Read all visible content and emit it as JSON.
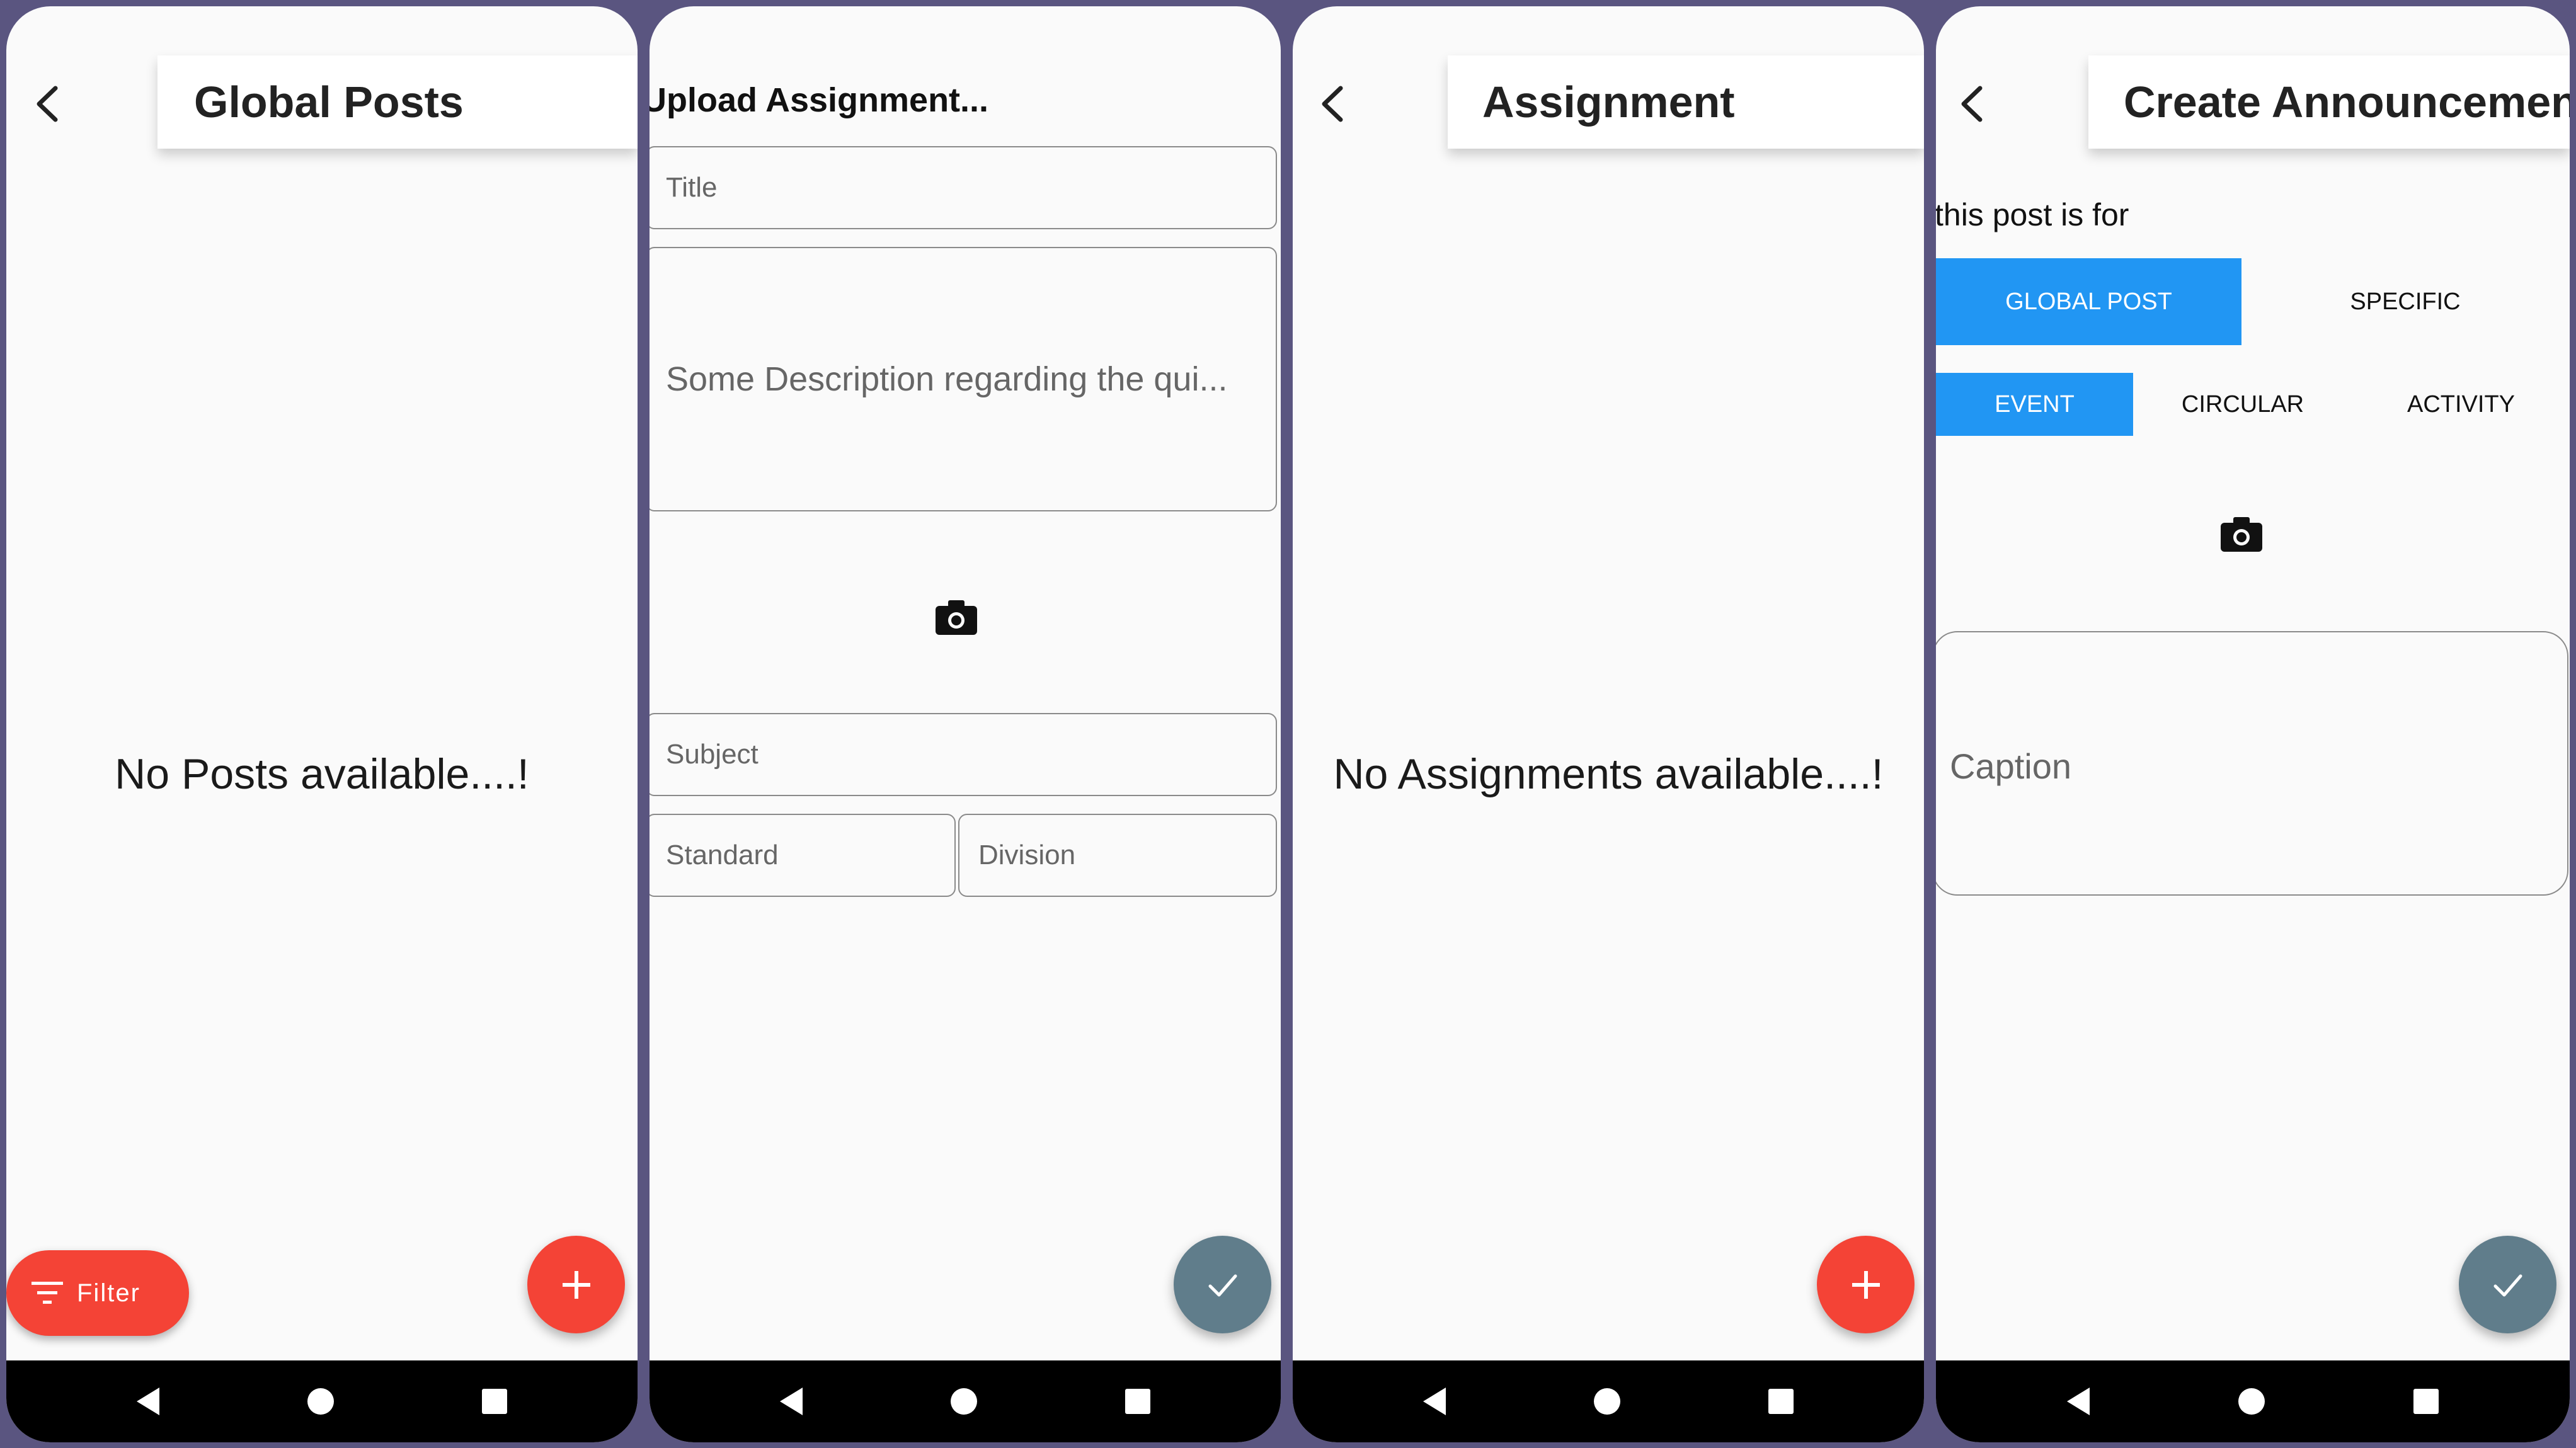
{
  "colors": {
    "frame": "#5a5580",
    "fab_red": "#f44336",
    "fab_gray": "#607d8b",
    "selected_blue": "#2196f3"
  },
  "screen1": {
    "title": "Global Posts",
    "empty_message": "No Posts available....!",
    "filter_label": "Filter",
    "icons": [
      "back-arrow-icon",
      "filter-icon",
      "plus-icon"
    ]
  },
  "screen2": {
    "title": "Upload Assignment...",
    "title_placeholder": "Title",
    "description_placeholder": "Some Description regarding the qui...",
    "subject_placeholder": "Subject",
    "standard_placeholder": "Standard",
    "division_placeholder": "Division",
    "icons": [
      "camera-icon",
      "check-icon"
    ]
  },
  "screen3": {
    "title": "Assignment",
    "empty_message": "No Assignments available....!",
    "icons": [
      "back-arrow-icon",
      "plus-icon"
    ]
  },
  "screen4": {
    "title": "Create Announcement",
    "post_for_label": "this post is for",
    "audience_options": [
      "GLOBAL POST",
      "SPECIFIC"
    ],
    "audience_selected": "GLOBAL POST",
    "type_options": [
      "EVENT",
      "CIRCULAR",
      "ACTIVITY"
    ],
    "type_selected": "EVENT",
    "caption_placeholder": "Caption",
    "icons": [
      "back-arrow-icon",
      "camera-icon",
      "check-icon"
    ]
  }
}
